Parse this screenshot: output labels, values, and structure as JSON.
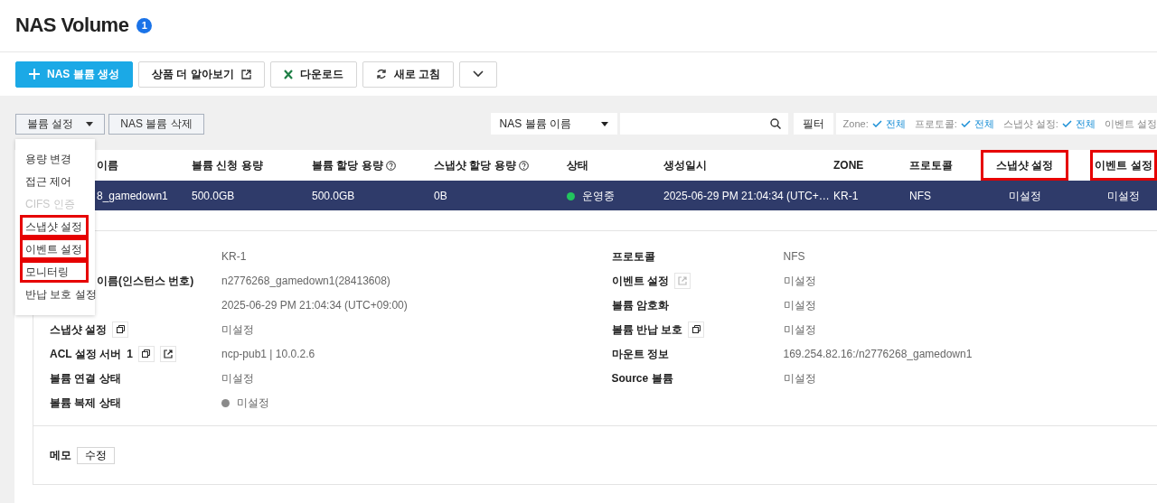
{
  "title": "NAS Volume",
  "title_badge": "1",
  "toolbar": [
    {
      "kind": "create",
      "label": "NAS 볼륨 생성"
    },
    {
      "kind": "link",
      "label": "상품 더 알아보기"
    },
    {
      "kind": "download",
      "label": "다운로드"
    },
    {
      "kind": "refresh",
      "label": "새로 고침"
    },
    {
      "kind": "more"
    }
  ],
  "actions": [
    {
      "label": "볼륨 설정",
      "dropdown": true
    },
    {
      "label": "NAS 볼륨 삭제",
      "dropdown": false
    }
  ],
  "search": {
    "select": "NAS 볼륨 이름"
  },
  "filter_button": "필터",
  "filters": [
    {
      "label": "Zone:",
      "value": "전체"
    },
    {
      "label": "프로토콜:",
      "value": "전체"
    },
    {
      "label": "스냅샷 설정:",
      "value": "전체"
    },
    {
      "label": "이벤트 설정"
    }
  ],
  "menu": [
    {
      "label": "용량 변경",
      "disabled": false,
      "highlighted": false
    },
    {
      "label": "접근 제어",
      "disabled": false,
      "highlighted": false
    },
    {
      "label": "CIFS 인증",
      "disabled": true,
      "highlighted": false
    },
    {
      "label": "스냅샷 설정",
      "disabled": false,
      "highlighted": true
    },
    {
      "label": "이벤트 설정",
      "disabled": false,
      "highlighted": true
    },
    {
      "label": "모니터링",
      "disabled": false,
      "highlighted": true
    },
    {
      "label": "반납 보호 설정",
      "disabled": false,
      "highlighted": false
    }
  ],
  "table": {
    "columns": [
      {
        "label": "이름",
        "help": false,
        "highlighted": false
      },
      {
        "label": "볼륨 신청 용량",
        "help": false,
        "highlighted": false
      },
      {
        "label": "볼륨 할당 용량",
        "help": true,
        "highlighted": false
      },
      {
        "label": "스냅샷 할당 용량",
        "help": true,
        "highlighted": false
      },
      {
        "label": "상태",
        "help": false,
        "highlighted": false
      },
      {
        "label": "생성일시",
        "help": false,
        "highlighted": false
      },
      {
        "label": "ZONE",
        "help": false,
        "highlighted": false
      },
      {
        "label": "프로토콜",
        "help": false,
        "highlighted": false
      },
      {
        "label": "스냅샷 설정",
        "help": false,
        "highlighted": true
      },
      {
        "label": "이벤트 설정",
        "help": false,
        "highlighted": true
      }
    ],
    "rows": [
      {
        "selected": true,
        "cells": [
          "8_gamedown1",
          "500.0GB",
          "500.0GB",
          "0B",
          "운영중",
          "2025-06-29 PM 21:04:34 (UTC+…",
          "KR-1",
          "NFS",
          "미설정",
          "미설정"
        ]
      }
    ]
  },
  "details_left": [
    {
      "value": "KR-1"
    },
    {
      "label": "이름(인스턴스 번호)",
      "partial": true,
      "value": "n2776268_gamedown1(28413608)"
    },
    {
      "value": "2025-06-29 PM 21:04:34 (UTC+09:00)"
    },
    {
      "label": "스냅샷 설정",
      "copy": true,
      "value": "미설정"
    },
    {
      "label": "ACL 설정 서버",
      "count": "1",
      "copy": true,
      "link": true,
      "value": "ncp-pub1 | 10.0.2.6"
    },
    {
      "label": "볼륨 연결 상태",
      "value": "미설정"
    },
    {
      "label": "볼륨 복제 상태",
      "value": "미설정",
      "dot": true
    }
  ],
  "details_right": [
    {
      "label": "프로토콜",
      "value": "NFS"
    },
    {
      "label": "이벤트 설정",
      "link": true,
      "link_disabled": true,
      "value": "미설정"
    },
    {
      "label": "볼륨 암호화",
      "value": "미설정"
    },
    {
      "label": "볼륨 반납 보호",
      "copy": true,
      "value": "미설정"
    },
    {
      "label": "마운트 정보",
      "value": "169.254.82.16:/n2776268_gamedown1"
    },
    {
      "label": "Source 볼륨",
      "value": "미설정"
    }
  ],
  "memo": {
    "label": "메모",
    "button": "수정"
  }
}
